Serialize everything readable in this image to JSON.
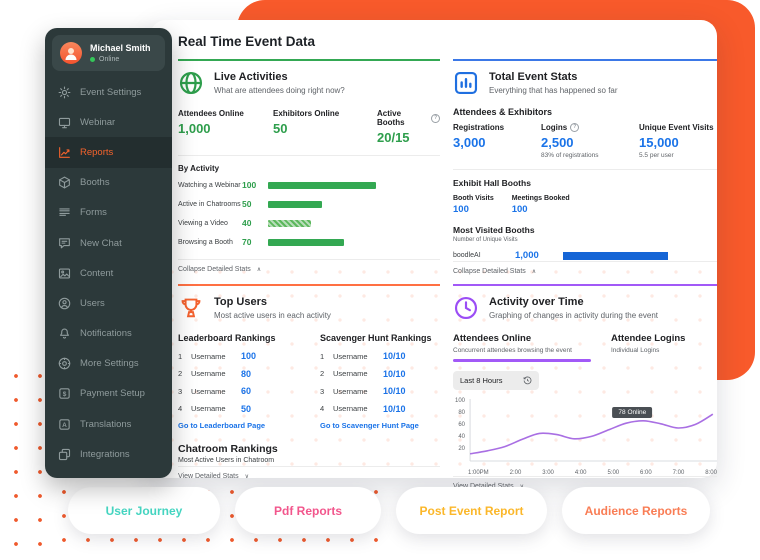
{
  "header": {
    "title": "Real Time Event Data"
  },
  "icons": {
    "caret_up": "∧",
    "caret_down": "∨",
    "info": "?"
  },
  "sidebar": {
    "user": {
      "name": "Michael Smith",
      "status": "Online"
    },
    "items": [
      {
        "label": "Event Settings"
      },
      {
        "label": "Webinar"
      },
      {
        "label": "Reports"
      },
      {
        "label": "Booths"
      },
      {
        "label": "Forms"
      },
      {
        "label": "New Chat"
      },
      {
        "label": "Content"
      },
      {
        "label": "Users"
      },
      {
        "label": "Notifications"
      },
      {
        "label": "More Settings"
      },
      {
        "label": "Payment Setup"
      },
      {
        "label": "Translations"
      },
      {
        "label": "Integrations"
      }
    ]
  },
  "live": {
    "title": "Live Activities",
    "subtitle": "What are attendees doing right now?",
    "stats": [
      {
        "label": "Attendees Online",
        "value": "1,000"
      },
      {
        "label": "Exhibitors Online",
        "value": "50"
      },
      {
        "label": "Active Booths",
        "value": "20/15"
      }
    ],
    "by_activity": "By Activity",
    "activities": [
      {
        "label": "Watching a Webinar",
        "value": 100
      },
      {
        "label": "Active in Chatrooms",
        "value": 50
      },
      {
        "label": "Viewing a Video",
        "value": 40
      },
      {
        "label": "Browsing a Booth",
        "value": 70
      }
    ],
    "collapse": "Collapse Detailed Stats"
  },
  "totals": {
    "title": "Total Event Stats",
    "subtitle": "Everything that has happened so far",
    "section1": "Attendees & Exhibitors",
    "stats": [
      {
        "label": "Registrations",
        "value": "3,000",
        "sub": ""
      },
      {
        "label": "Logins",
        "value": "2,500",
        "sub": "83% of registrations"
      },
      {
        "label": "Unique Event Visits",
        "value": "15,000",
        "sub": "5.5 per user"
      }
    ],
    "section2": "Exhibit Hall Booths",
    "booth_stats": [
      {
        "label": "Booth Visits",
        "value": "100"
      },
      {
        "label": "Meetings Booked",
        "value": "100"
      }
    ],
    "section3": "Most Visited Booths",
    "section3_sub": "Number of Unique Visits",
    "most_visited": [
      {
        "label": "boodleAI",
        "value": "1,000",
        "value_num": 1000
      }
    ],
    "collapse": "Collapse Detailed Stats"
  },
  "top_users": {
    "title": "Top Users",
    "subtitle": "Most active users in each activity",
    "leaderboard": {
      "title": "Leaderboard Rankings",
      "rows": [
        {
          "rank": "1",
          "name": "Username",
          "value": "100"
        },
        {
          "rank": "2",
          "name": "Username",
          "value": "80"
        },
        {
          "rank": "3",
          "name": "Username",
          "value": "60"
        },
        {
          "rank": "4",
          "name": "Username",
          "value": "50"
        }
      ],
      "link": "Go to Leaderboard Page"
    },
    "scavenger": {
      "title": "Scavenger Hunt Rankings",
      "rows": [
        {
          "rank": "1",
          "name": "Username",
          "value": "10/10"
        },
        {
          "rank": "2",
          "name": "Username",
          "value": "10/10"
        },
        {
          "rank": "3",
          "name": "Username",
          "value": "10/10"
        },
        {
          "rank": "4",
          "name": "Username",
          "value": "10/10"
        }
      ],
      "link": "Go to Scavenger Hunt Page"
    },
    "chatroom": {
      "title": "Chatroom Rankings",
      "subtitle": "Most Active Users in Chatroom"
    },
    "view_stats": "View Detailed Stats"
  },
  "activity_time": {
    "title": "Activity over Time",
    "subtitle": "Graphing of changes in activity during the event",
    "tabs": [
      {
        "label": "Attendees Online",
        "sub": "Concurrent attendees browsing the event"
      },
      {
        "label": "Attendee Logins",
        "sub": "Individual Logins"
      }
    ],
    "range_button": "Last 8 Hours",
    "view_stats": "View Detailed Stats"
  },
  "chart_data": {
    "type": "line",
    "title": "Attendees Online over time",
    "xlabel": "",
    "ylabel": "",
    "x_labels": [
      "1:00PM",
      "2:00",
      "3:00",
      "4:00",
      "5:00",
      "6:00",
      "7:00",
      "8:00"
    ],
    "y_ticks": [
      100,
      80,
      60,
      40,
      20
    ],
    "ylim": [
      0,
      100
    ],
    "series": [
      {
        "name": "Attendees Online",
        "values": [
          12,
          17,
          24,
          36,
          46,
          44,
          37,
          41,
          52,
          63,
          67,
          62,
          55,
          61,
          78
        ]
      }
    ],
    "tooltip": "78 Online",
    "line_color": "#a96fe3",
    "legend_position": "none",
    "grid": false
  },
  "footer_buttons": [
    {
      "label": "User Journey",
      "color": "#45d5c1"
    },
    {
      "label": "Pdf Reports",
      "color": "#f2568c"
    },
    {
      "label": "Post Event Report",
      "color": "#fbb72a"
    },
    {
      "label": "Audience Reports",
      "color": "#f97d55"
    }
  ],
  "colors": {
    "background_shape": "#f85a2b",
    "sidebar_bg": "#2c393a",
    "sidebar_active": "#f4632c",
    "green": "#2e9e4c",
    "blue": "#1a73e8",
    "orange": "#ff7043",
    "purple": "#a259f7"
  }
}
